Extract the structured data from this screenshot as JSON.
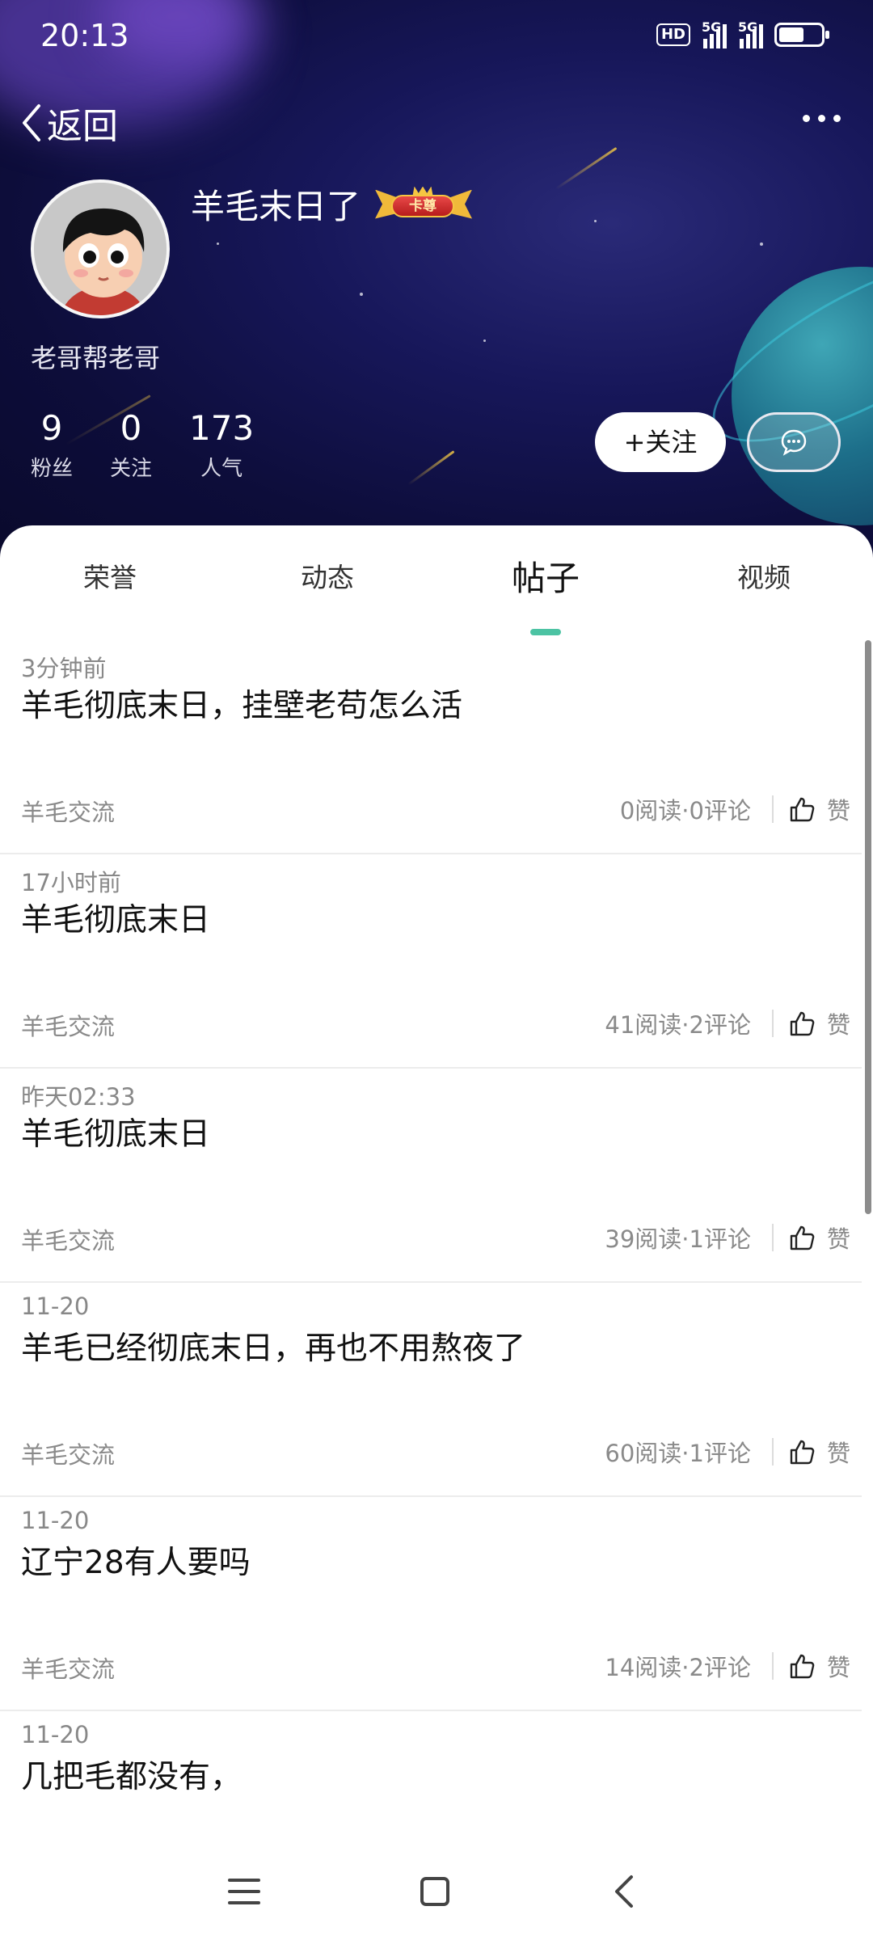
{
  "status_bar": {
    "time": "20:13",
    "hd_label": "HD",
    "network_1": "5G",
    "network_2": "5G",
    "battery_level": 0.6,
    "icons": [
      "hd-icon",
      "signal-5g-icon",
      "signal-5g-icon",
      "battery-icon"
    ]
  },
  "nav": {
    "back_label": "返回",
    "more_icon": "more-dots-icon"
  },
  "profile": {
    "name": "羊毛末日了",
    "badge_text": "卡尊",
    "signature": "老哥帮老哥",
    "stats": [
      {
        "value": "9",
        "label": "粉丝"
      },
      {
        "value": "0",
        "label": "关注"
      },
      {
        "value": "173",
        "label": "人气"
      }
    ],
    "follow_label": "+关注",
    "chat_icon": "chat-bubble-icon"
  },
  "tabs": [
    {
      "label": "荣誉",
      "active": false
    },
    {
      "label": "动态",
      "active": false
    },
    {
      "label": "帖子",
      "active": true
    },
    {
      "label": "视频",
      "active": false
    }
  ],
  "posts": [
    {
      "time": "3分钟前",
      "title": "羊毛彻底末日，挂壁老苟怎么活",
      "category": "羊毛交流",
      "counts": "0阅读·0评论",
      "like_label": "赞"
    },
    {
      "time": "17小时前",
      "title": "羊毛彻底末日",
      "category": "羊毛交流",
      "counts": "41阅读·2评论",
      "like_label": "赞"
    },
    {
      "time": "昨天02:33",
      "title": "羊毛彻底末日",
      "category": "羊毛交流",
      "counts": "39阅读·1评论",
      "like_label": "赞"
    },
    {
      "time": "11-20",
      "title": "羊毛已经彻底末日，再也不用熬夜了",
      "category": "羊毛交流",
      "counts": "60阅读·1评论",
      "like_label": "赞"
    },
    {
      "time": "11-20",
      "title": "辽宁28有人要吗",
      "category": "羊毛交流",
      "counts": "14阅读·2评论",
      "like_label": "赞"
    },
    {
      "time": "11-20",
      "title": "几把毛都没有，"
    }
  ],
  "colors": {
    "accent": "#4cc3a3",
    "header_bg": "#17175a"
  },
  "system_nav": [
    "menu-icon",
    "home-square-icon",
    "back-chevron-icon"
  ]
}
